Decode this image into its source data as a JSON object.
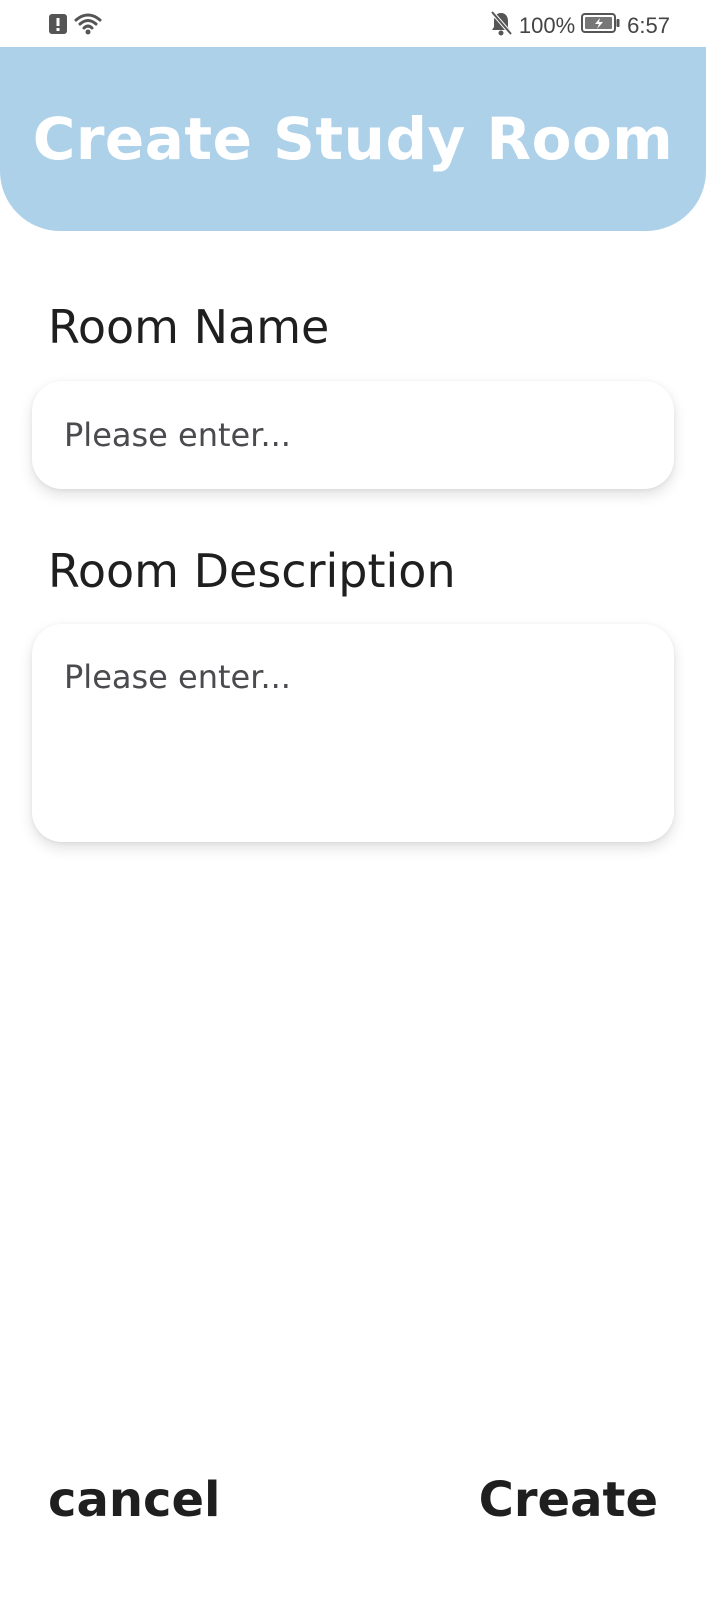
{
  "status_bar": {
    "left_icons": [
      "alert-icon",
      "wifi-icon"
    ],
    "right_icons": [
      "bell-muted-icon",
      "battery-icon"
    ],
    "battery": "100%",
    "time": "6:57"
  },
  "header": {
    "title": "Create Study Room",
    "color": "#aed1ea"
  },
  "form": {
    "room_name": {
      "label": "Room Name",
      "placeholder": "Please enter...",
      "value": ""
    },
    "room_description": {
      "label": "Room Description",
      "placeholder": "Please enter...",
      "value": ""
    }
  },
  "actions": {
    "cancel": "cancel",
    "create": "Create"
  }
}
